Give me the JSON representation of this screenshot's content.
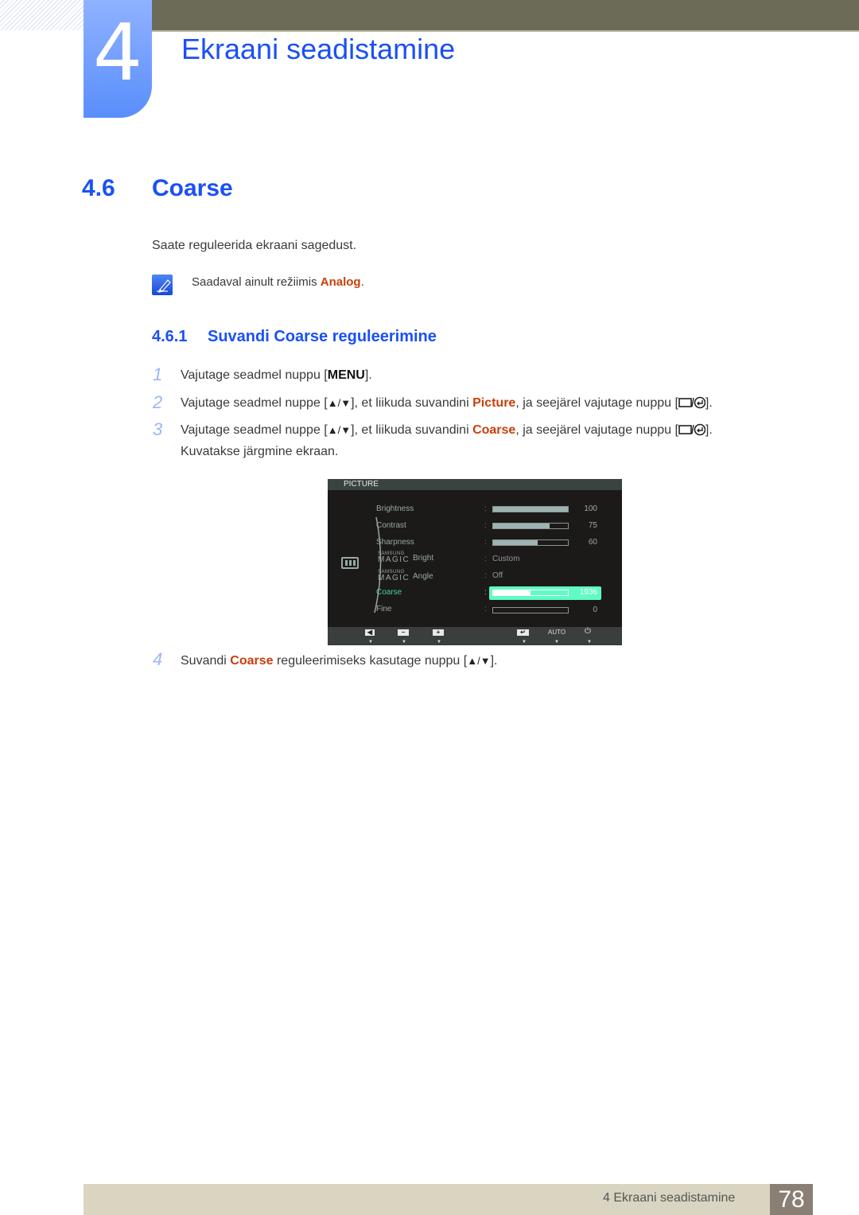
{
  "chapter": {
    "number": "4",
    "title": "Ekraani seadistamine"
  },
  "section": {
    "number": "4.6",
    "title": "Coarse"
  },
  "intro": "Saate reguleerida ekraani sagedust.",
  "note": {
    "icon": "note-pencil-icon",
    "text_before": "Saadaval ainult režiimis ",
    "highlight": "Analog",
    "text_after": "."
  },
  "subsection": {
    "number": "4.6.1",
    "title": "Suvandi Coarse reguleerimine"
  },
  "steps": [
    {
      "n": "1",
      "text_before": "Vajutage seadmel nuppu [",
      "key": "MENU",
      "text_after": "]."
    },
    {
      "n": "2",
      "text_before": "Vajutage seadmel nuppe [",
      "keys": "▲/▼",
      "text_mid": "], et liikuda suvandini ",
      "highlight": "Picture",
      "text_after": ", ja seejärel vajutage nuppu [",
      "end": "]."
    },
    {
      "n": "3",
      "text_before": "Vajutage seadmel nuppe [",
      "keys": "▲/▼",
      "text_mid": "], et liikuda suvandini ",
      "highlight": "Coarse",
      "text_after": ", ja seejärel vajutage nuppu [",
      "end": "].",
      "line2": "Kuvatakse järgmine ekraan."
    },
    {
      "n": "4",
      "text_before": "Suvandi ",
      "highlight": "Coarse",
      "text_after": " reguleerimiseks kasutage nuppu [",
      "keys": "▲/▼",
      "end": "]."
    }
  ],
  "osd": {
    "title": "PICTURE",
    "items": [
      {
        "label": "Brightness",
        "value": "100",
        "fill": 1.0
      },
      {
        "label": "Contrast",
        "value": "75",
        "fill": 0.75
      },
      {
        "label": "Sharpness",
        "value": "60",
        "fill": 0.6
      },
      {
        "brand_small": "SAMSUNG",
        "brand": "MAGIC",
        "label": "Bright",
        "text_value": "Custom"
      },
      {
        "brand_small": "SAMSUNG",
        "brand": "MAGIC",
        "label": "Angle",
        "text_value": "Off"
      },
      {
        "label": "Coarse",
        "value": "1936",
        "fill": 0.5,
        "selected": true
      },
      {
        "label": "Fine",
        "value": "0",
        "fill": 0.0
      }
    ],
    "buttons": {
      "auto": "AUTO",
      "power": "⏻",
      "left": "◀",
      "minus": "−",
      "plus": "+",
      "enter": "↵"
    }
  },
  "footer": {
    "text": "4 Ekraani seadistamine",
    "page": "78"
  }
}
